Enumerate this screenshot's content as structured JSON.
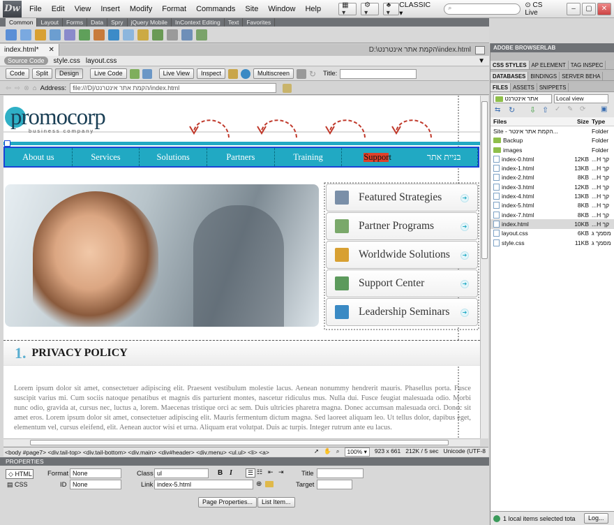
{
  "app": {
    "logo": "Dw",
    "menu": [
      "File",
      "Edit",
      "View",
      "Insert",
      "Modify",
      "Format",
      "Commands",
      "Site",
      "Window",
      "Help"
    ],
    "workspace": "CLASSIC",
    "cslive": "CS Live"
  },
  "insert_tabs": [
    "Common",
    "Layout",
    "Forms",
    "Data",
    "Spry",
    "jQuery Mobile",
    "InContext Editing",
    "Text",
    "Favorites"
  ],
  "document": {
    "tab": "index.html*",
    "path": "D:\\הקמת אתר אינטרנט\\index.html",
    "related": [
      "Source Code",
      "style.css",
      "layout.css"
    ],
    "toolbar": {
      "code": "Code",
      "split": "Split",
      "design": "Design",
      "live_code": "Live Code",
      "live_view": "Live View",
      "inspect": "Inspect",
      "multiscreen": "Multiscreen",
      "title_label": "Title:"
    },
    "address_label": "Address:",
    "address": "file:///D|/הקמת אתר אינטרנט/index.html"
  },
  "page": {
    "logo_main": "promocorp",
    "logo_sub": "business company",
    "nav": [
      "About us",
      "Services",
      "Solutions",
      "Partners",
      "Training",
      "Support",
      "בניית אתר"
    ],
    "features": [
      "Featured Strategies",
      "Partner Programs",
      "Worldwide Solutions",
      "Support Center",
      "Leadership Seminars"
    ],
    "policy_num": "1.",
    "policy_title": "PRIVACY POLICY",
    "lorem": "Lorem ipsum dolor sit amet, consectetuer adipiscing elit. Praesent vestibulum molestie lacus. Aenean nonummy hendrerit mauris. Phasellus porta. Fusce suscipit varius mi. Cum sociis natoque penatibus et magnis dis parturient montes, nascetur ridiculus mus. Nulla dui. Fusce feugiat malesuada odio. Morbi nunc odio, gravida at, cursus nec, luctus a, lorem. Maecenas tristique orci ac sem. Duis ultricies pharetra magna. Donec accumsan malesuada orci. Donec sit amet eros. Lorem ipsum dolor sit amet, consectetuer adipiscing elit. Mauris fermentum dictum magna. Sed laoreet aliquam leo. Ut tellus dolor, dapibus eget, elementum vel, cursus eleifend, elit. Aenean auctor wisi et urna. Aliquam erat volutpat. Duis ac turpis. Integer rutrum ante eu lacus."
  },
  "tagbar": {
    "path": "<body #page7> <div.tail-top> <div.tail-bottom> <div.main> <div#header> <div.menu> <ul.ul> <li> <a>",
    "zoom": "100%",
    "size": "923 x 661",
    "weight": "212K / 5 sec",
    "encoding": "Unicode (UTF-8"
  },
  "properties": {
    "header": "PROPERTIES",
    "html": "HTML",
    "css": "CSS",
    "format_label": "Format",
    "format": "None",
    "id_label": "ID",
    "id": "None",
    "class_label": "Class",
    "class": "ul",
    "link_label": "Link",
    "link": "index-5.html",
    "title_label": "Title",
    "target_label": "Target",
    "page_props": "Page Properties...",
    "list_item": "List Item..."
  },
  "panel": {
    "browserlab": "ADOBE BROWSERLAB",
    "tabs1": [
      "CSS STYLES",
      "AP ELEMENT",
      "TAG INSPEC"
    ],
    "tabs2": [
      "DATABASES",
      "BINDINGS",
      "SERVER BEHA"
    ],
    "tabs3": [
      "FILES",
      "ASSETS",
      "SNIPPETS"
    ],
    "site": "אתר אינטרנט",
    "view": "Local view",
    "columns": [
      "Files",
      "Size",
      "Type"
    ],
    "files": [
      {
        "name": "Site - הקמת אתר אינטר...",
        "size": "",
        "type": "Folder",
        "kind": "site"
      },
      {
        "name": "Backup",
        "size": "",
        "type": "Folder",
        "kind": "folder"
      },
      {
        "name": "images",
        "size": "",
        "type": "Folder",
        "kind": "folder"
      },
      {
        "name": "index-0.html",
        "size": "12KB",
        "type": "...H קך",
        "kind": "file"
      },
      {
        "name": "index-1.html",
        "size": "13KB",
        "type": "...H קך",
        "kind": "file"
      },
      {
        "name": "index-2.html",
        "size": "8KB",
        "type": "...H קך",
        "kind": "file"
      },
      {
        "name": "index-3.html",
        "size": "12KB",
        "type": "...H קך",
        "kind": "file"
      },
      {
        "name": "index-4.html",
        "size": "13KB",
        "type": "...H קך",
        "kind": "file"
      },
      {
        "name": "index-5.html",
        "size": "8KB",
        "type": "...H קך",
        "kind": "file"
      },
      {
        "name": "index-7.html",
        "size": "8KB",
        "type": "...H קך",
        "kind": "file"
      },
      {
        "name": "index.html",
        "size": "10KB",
        "type": "...H קך",
        "kind": "file",
        "selected": true
      },
      {
        "name": "layout.css",
        "size": "6KB",
        "type": "מסמך ג",
        "kind": "file"
      },
      {
        "name": "style.css",
        "size": "11KB",
        "type": "מסמך ג",
        "kind": "file"
      }
    ],
    "status": "1 local items selected tota",
    "log": "Log..."
  }
}
